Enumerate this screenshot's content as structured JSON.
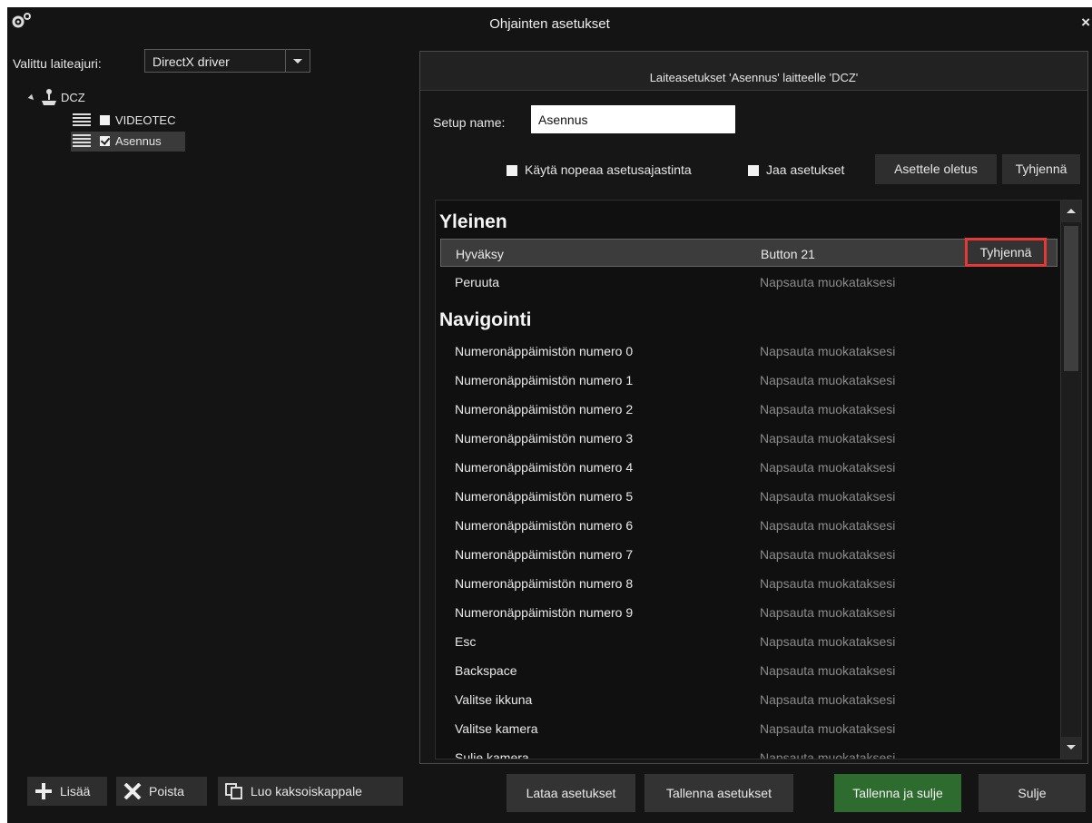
{
  "window": {
    "title": "Ohjainten asetukset"
  },
  "driver": {
    "label": "Valittu laiteajuri:",
    "selected": "DirectX driver"
  },
  "tree": {
    "root": "DCZ",
    "items": [
      {
        "label": "VIDEOTEC",
        "checked": false
      },
      {
        "label": "Asennus",
        "checked": true
      }
    ]
  },
  "left_buttons": {
    "add": "Lisää",
    "remove": "Poista",
    "duplicate": "Luo kaksoiskappale"
  },
  "panel": {
    "header": "Laiteasetukset 'Asennus' laitteelle 'DCZ'",
    "setup_label": "Setup name:",
    "setup_value": "Asennus",
    "quick_timer": "Käytä nopeaa asetusajastinta",
    "share": "Jaa asetukset",
    "set_default": "Asettele oletus",
    "clear_all": "Tyhjennä"
  },
  "sections": [
    {
      "title": "Yleinen",
      "rows": [
        {
          "name": "Hyväksy",
          "value": "Button 21",
          "clear": "Tyhjennä"
        },
        {
          "name": "Peruuta",
          "value": "Napsauta muokataksesi"
        }
      ]
    },
    {
      "title": "Navigointi",
      "rows": [
        {
          "name": "Numeronäppäimistön numero 0",
          "value": "Napsauta muokataksesi"
        },
        {
          "name": "Numeronäppäimistön numero 1",
          "value": "Napsauta muokataksesi"
        },
        {
          "name": "Numeronäppäimistön numero 2",
          "value": "Napsauta muokataksesi"
        },
        {
          "name": "Numeronäppäimistön numero 3",
          "value": "Napsauta muokataksesi"
        },
        {
          "name": "Numeronäppäimistön numero 4",
          "value": "Napsauta muokataksesi"
        },
        {
          "name": "Numeronäppäimistön numero 5",
          "value": "Napsauta muokataksesi"
        },
        {
          "name": "Numeronäppäimistön numero 6",
          "value": "Napsauta muokataksesi"
        },
        {
          "name": "Numeronäppäimistön numero 7",
          "value": "Napsauta muokataksesi"
        },
        {
          "name": "Numeronäppäimistön numero 8",
          "value": "Napsauta muokataksesi"
        },
        {
          "name": "Numeronäppäimistön numero 9",
          "value": "Napsauta muokataksesi"
        },
        {
          "name": "Esc",
          "value": "Napsauta muokataksesi"
        },
        {
          "name": "Backspace",
          "value": "Napsauta muokataksesi"
        },
        {
          "name": "Valitse ikkuna",
          "value": "Napsauta muokataksesi"
        },
        {
          "name": "Valitse kamera",
          "value": "Napsauta muokataksesi"
        },
        {
          "name": "Sulje kamera",
          "value": "Napsauta muokataksesi"
        }
      ]
    }
  ],
  "footer": {
    "load": "Lataa asetukset",
    "save": "Tallenna asetukset",
    "save_close": "Tallenna ja sulje",
    "close": "Sulje"
  },
  "colors": {
    "highlight": "#e53935",
    "primary_button": "#2e6b2e"
  }
}
